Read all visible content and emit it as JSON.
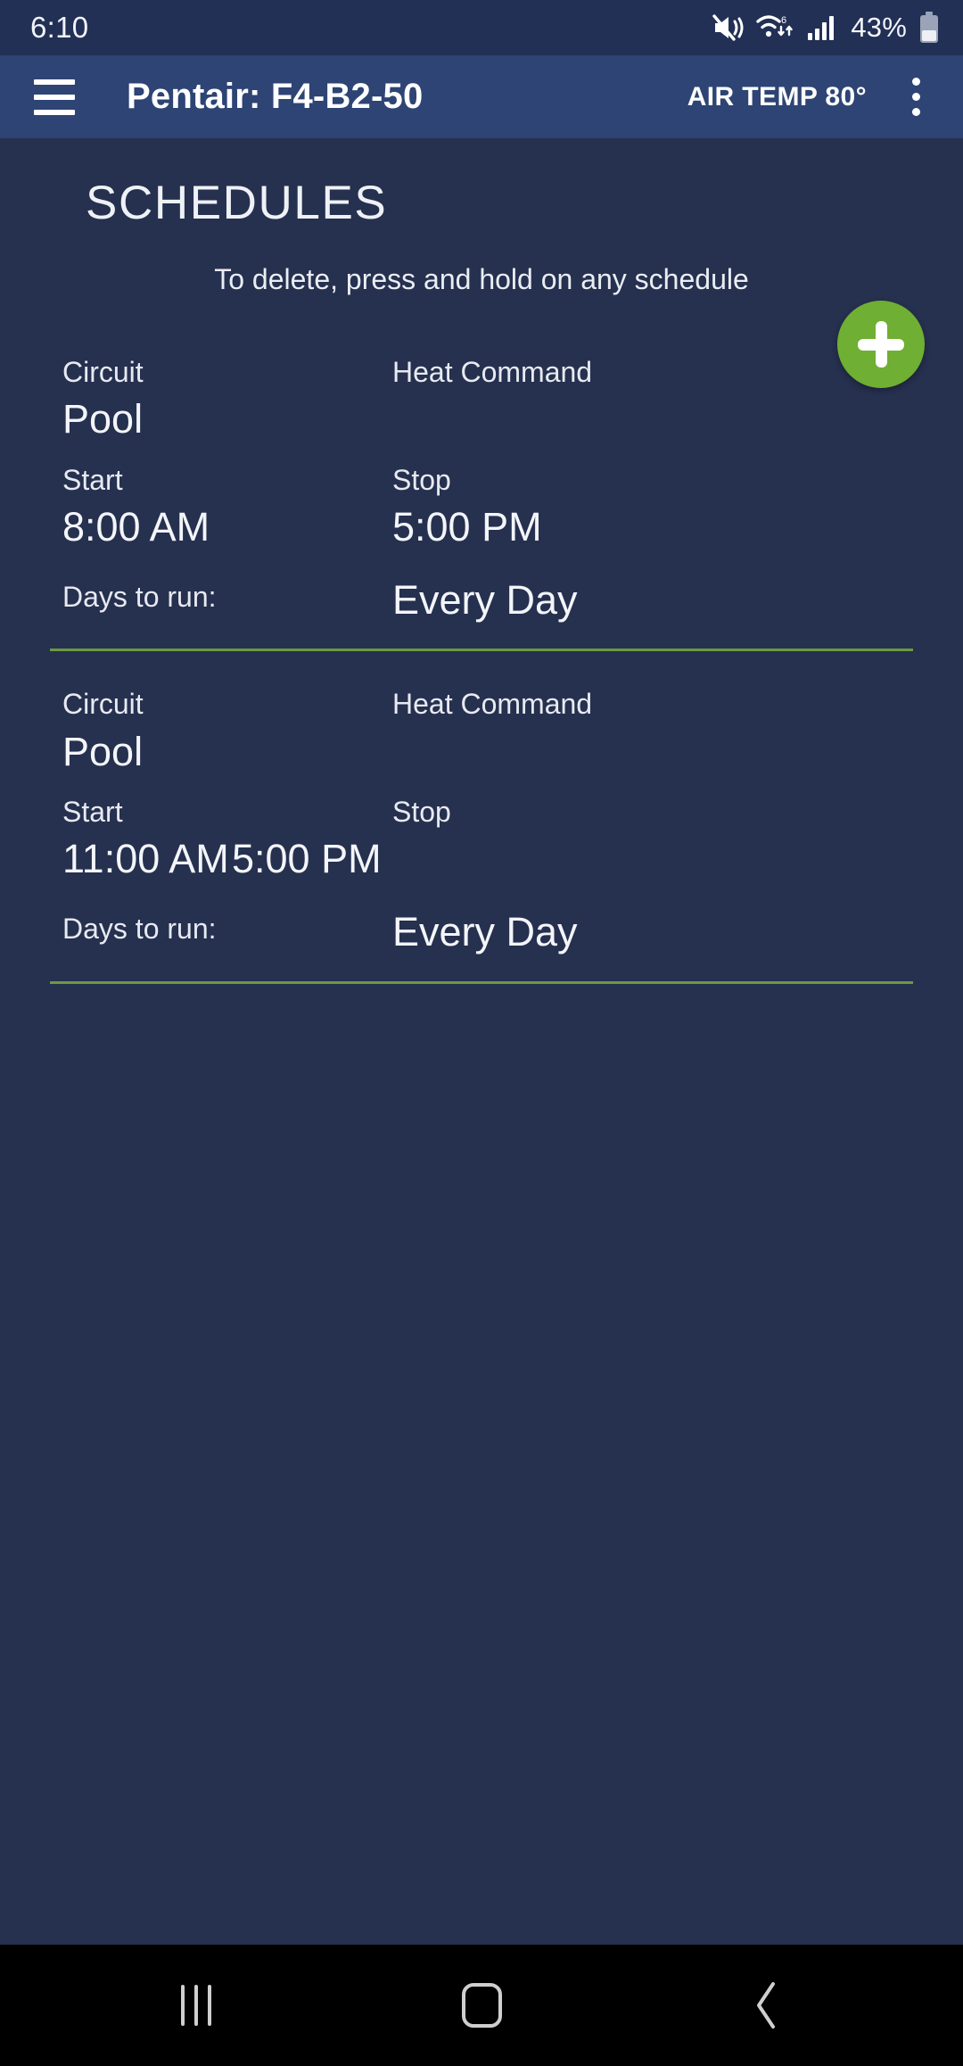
{
  "status_bar": {
    "time": "6:10",
    "battery_percent": "43%",
    "icons": [
      "mute-icon",
      "wifi-6-icon",
      "cellular-signal-icon",
      "battery-icon"
    ]
  },
  "app_bar": {
    "menu_icon": "hamburger-menu-icon",
    "title": "Pentair: F4-B2-50",
    "air_temp": "AIR TEMP 80°",
    "overflow_icon": "kebab-menu-icon"
  },
  "page": {
    "title": "SCHEDULES",
    "hint": "To delete, press and hold on any schedule",
    "add_icon": "plus-icon",
    "accent_green": "#6faf33",
    "divider_green": "#6c9a3f",
    "background": "#26304f",
    "app_bar_color": "#2d4474"
  },
  "labels": {
    "circuit": "Circuit",
    "heat_command": "Heat Command",
    "start": "Start",
    "stop": "Stop",
    "days_to_run": "Days to run:"
  },
  "schedules": [
    {
      "circuit": "Pool",
      "heat_command": "",
      "start": "8:00 AM",
      "stop": "5:00 PM",
      "days": "Every Day"
    },
    {
      "circuit": "Pool",
      "heat_command": "",
      "start": "11:00 AM",
      "stop": "5:00 PM",
      "days": "Every Day"
    }
  ],
  "nav_bar": {
    "recents_icon": "recents-icon",
    "home_icon": "home-icon",
    "back_icon": "back-icon"
  }
}
